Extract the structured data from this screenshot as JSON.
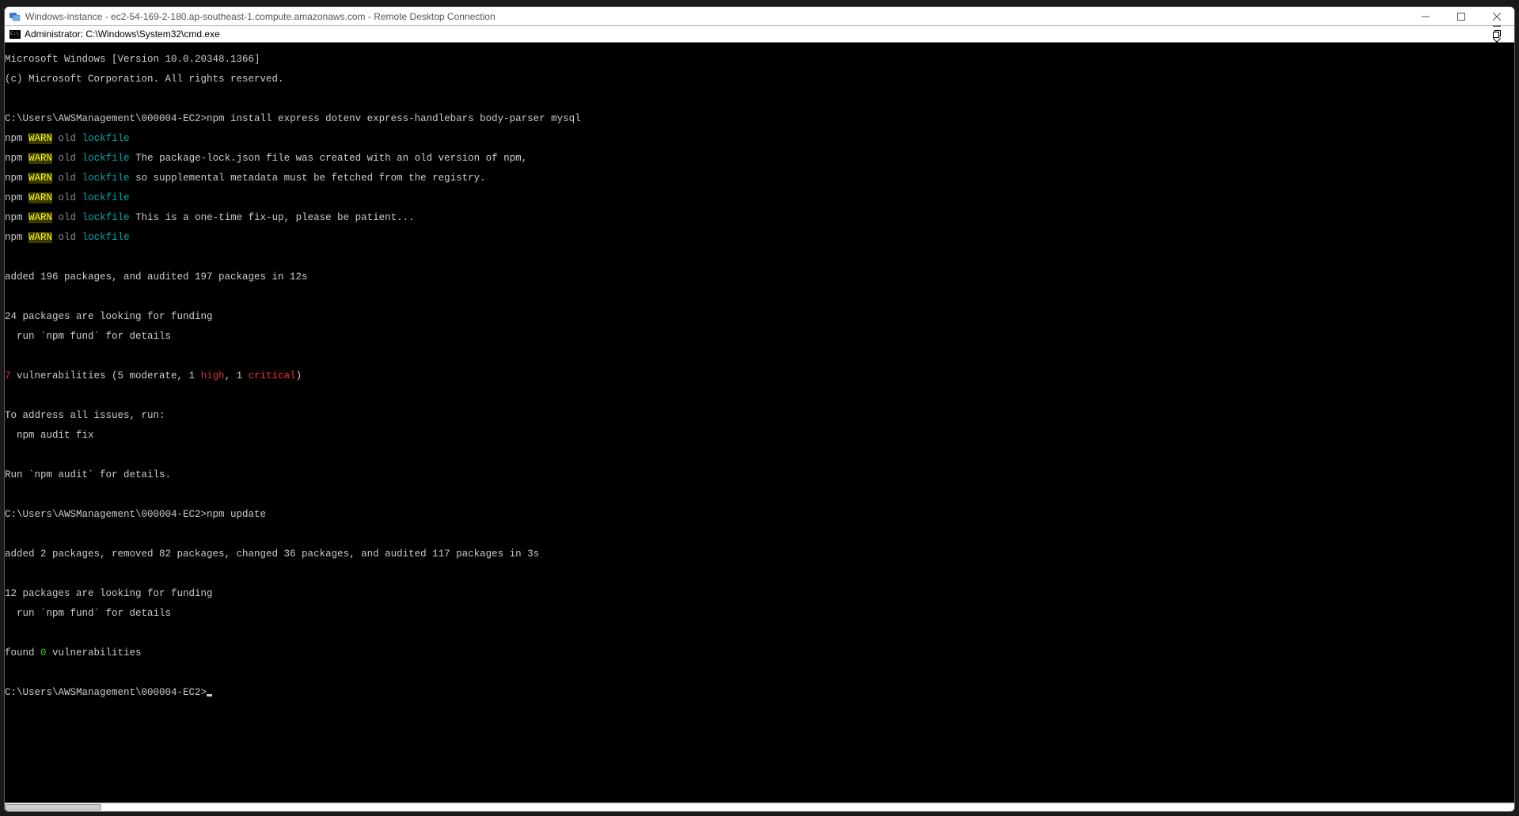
{
  "rdp": {
    "title": "Windows-instance - ec2-54-169-2-180.ap-southeast-1.compute.amazonaws.com - Remote Desktop Connection"
  },
  "cmd": {
    "title": "Administrator: C:\\Windows\\System32\\cmd.exe"
  },
  "term": {
    "l1": "Microsoft Windows [Version 10.0.20348.1366]",
    "l2": "(c) Microsoft Corporation. All rights reserved.",
    "prompt1": "C:\\Users\\AWSManagement\\000004-EC2>",
    "cmd1": "npm install express dotenv express-handlebars body-parser mysql",
    "npm": "npm ",
    "WARN": "WARN",
    "sp": " ",
    "old": "old ",
    "lockfile": "lockfile",
    "w_msg1": " The package-lock.json file was created with an old version of npm,",
    "w_msg2": " so supplemental metadata must be fetched from the registry.",
    "w_msg3": " This is a one-time fix-up, please be patient...",
    "added1": "added 196 packages, and audited 197 packages in 12s",
    "fund1_a": "24 packages are looking for funding",
    "fund1_b": "  run `npm fund` for details",
    "severity7": "7",
    "vuln_mid_a": " vulnerabilities (5 moderate, 1 ",
    "high": "high",
    "vuln_mid_b": ", 1 ",
    "critical": "critical",
    "vuln_end": ")",
    "address1": "To address all issues, run:",
    "address2": "  npm audit fix",
    "audit_hint": "Run `npm audit` for details.",
    "prompt2": "C:\\Users\\AWSManagement\\000004-EC2>",
    "cmd2": "npm update",
    "added2": "added 2 packages, removed 82 packages, changed 36 packages, and audited 117 packages in 3s",
    "fund2_a": "12 packages are looking for funding",
    "fund2_b": "  run `npm fund` for details",
    "found_pre": "found ",
    "zero": "0",
    "found_post": " vulnerabilities",
    "prompt3": "C:\\Users\\AWSManagement\\000004-EC2>"
  }
}
